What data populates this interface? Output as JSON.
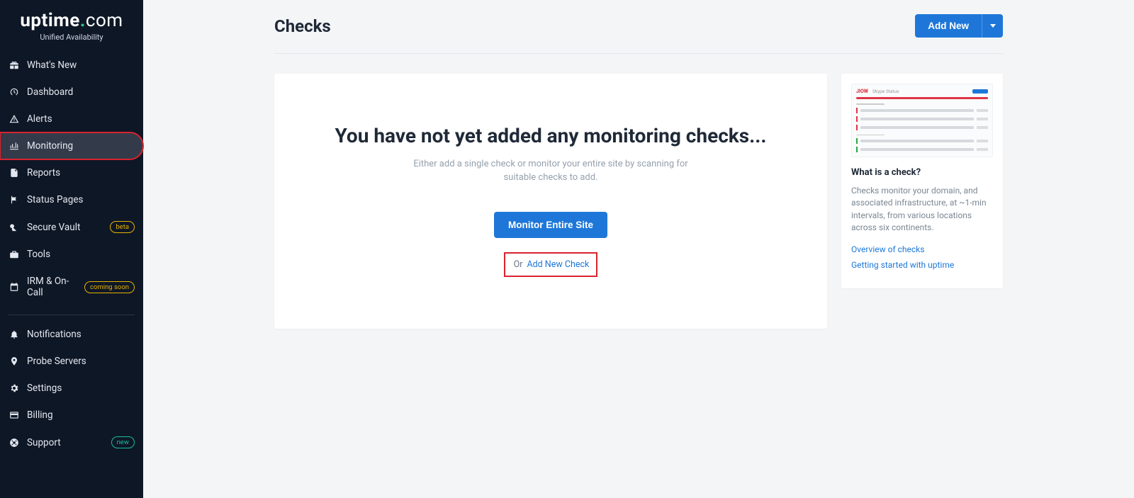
{
  "brand": {
    "name_a": "uptime",
    "name_b": ".com",
    "tagline": "Unified Availability"
  },
  "sidebar": {
    "items": [
      {
        "label": "What's New",
        "icon": "gift-icon"
      },
      {
        "label": "Dashboard",
        "icon": "gauge-icon"
      },
      {
        "label": "Alerts",
        "icon": "warning-icon"
      },
      {
        "label": "Monitoring",
        "icon": "monitor-icon",
        "active": true,
        "highlight": true
      },
      {
        "label": "Reports",
        "icon": "report-icon"
      },
      {
        "label": "Status Pages",
        "icon": "flag-icon"
      },
      {
        "label": "Secure Vault",
        "icon": "key-icon",
        "badge": "beta",
        "badgeColor": "yellow"
      },
      {
        "label": "Tools",
        "icon": "toolbox-icon"
      },
      {
        "label": "IRM & On-Call",
        "icon": "calendar-icon",
        "badge": "coming soon",
        "badgeColor": "yellow"
      }
    ],
    "items2": [
      {
        "label": "Notifications",
        "icon": "bell-icon"
      },
      {
        "label": "Probe Servers",
        "icon": "pin-icon"
      },
      {
        "label": "Settings",
        "icon": "gear-icon"
      },
      {
        "label": "Billing",
        "icon": "card-icon"
      },
      {
        "label": "Support",
        "icon": "life-ring-icon",
        "badge": "new",
        "badgeColor": "green"
      }
    ]
  },
  "header": {
    "title": "Checks",
    "add_new": "Add New"
  },
  "empty": {
    "heading": "You have not yet added any monitoring checks...",
    "sub": "Either add a single check or monitor your entire site by scanning for suitable checks to add.",
    "monitor_btn": "Monitor Entire Site",
    "or": "Or",
    "add_link": "Add New Check"
  },
  "side": {
    "preview_title": "Skype Status",
    "preview_brand": "JIOW",
    "h": "What is a check?",
    "p": "Checks monitor your domain, and associated infrastructure, at ~1-min intervals, from various locations across six continents.",
    "link1": "Overview of checks",
    "link2": "Getting started with uptime"
  }
}
